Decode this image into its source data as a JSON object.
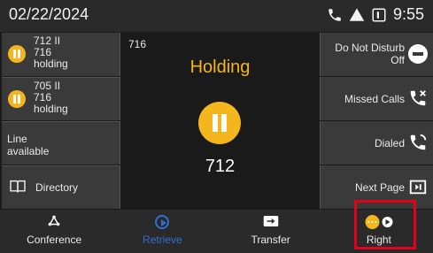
{
  "status_bar": {
    "date": "02/22/2024",
    "time": "9:55",
    "icons": [
      "phone-icon",
      "warning-icon",
      "voicemail-icon"
    ]
  },
  "left_lines": [
    {
      "title": "712 II",
      "line": "716",
      "status": "holding",
      "icon": "pause-icon"
    },
    {
      "title": "705 II",
      "line": "716",
      "status": "holding",
      "icon": "pause-icon"
    },
    {
      "line": "Line",
      "status": "available"
    },
    {
      "label": "Directory",
      "icon": "book-icon"
    }
  ],
  "center": {
    "line_number": "716",
    "call_state": "Holding",
    "callee": "712",
    "state_icon": "pause-icon"
  },
  "right_keys": [
    {
      "label": "Do Not Disturb",
      "sublabel": "Off",
      "icon": "dnd-icon"
    },
    {
      "label": "Missed Calls",
      "icon": "missed-call-icon"
    },
    {
      "label": "Dialed",
      "icon": "dialed-call-icon"
    },
    {
      "label": "Next Page",
      "icon": "next-page-icon"
    }
  ],
  "softkeys": [
    {
      "label": "Conference",
      "icon": "conference-icon"
    },
    {
      "label": "Retrieve",
      "icon": "retrieve-icon",
      "disabled": true
    },
    {
      "label": "Transfer",
      "icon": "transfer-icon"
    },
    {
      "label": "Right",
      "icon": "more-icon"
    }
  ],
  "colors": {
    "accent": "#f5b51c",
    "highlight": "#e3001b",
    "disabled": "#2f6fd1"
  }
}
